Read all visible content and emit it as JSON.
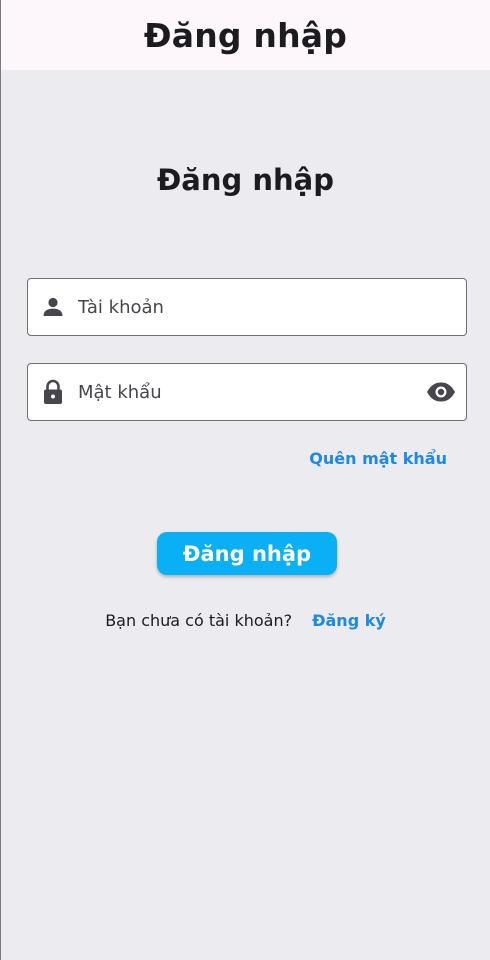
{
  "appbar": {
    "title": "Đăng nhập"
  },
  "heading": "Đăng nhập",
  "username": {
    "placeholder": "Tài khoản",
    "icon": "person-icon"
  },
  "password": {
    "placeholder": "Mật khẩu",
    "icon": "lock-icon",
    "toggle_icon": "eye-icon"
  },
  "forgot_password": "Quên mật khẩu",
  "login_button": "Đăng nhập",
  "signup": {
    "prompt": "Bạn chưa có tài khoản?",
    "link": "Đăng ký"
  },
  "colors": {
    "accent": "#0ab0f5",
    "link": "#1e88e5",
    "appbar_bg": "#fdf6fb",
    "page_bg": "#ebebf0"
  }
}
